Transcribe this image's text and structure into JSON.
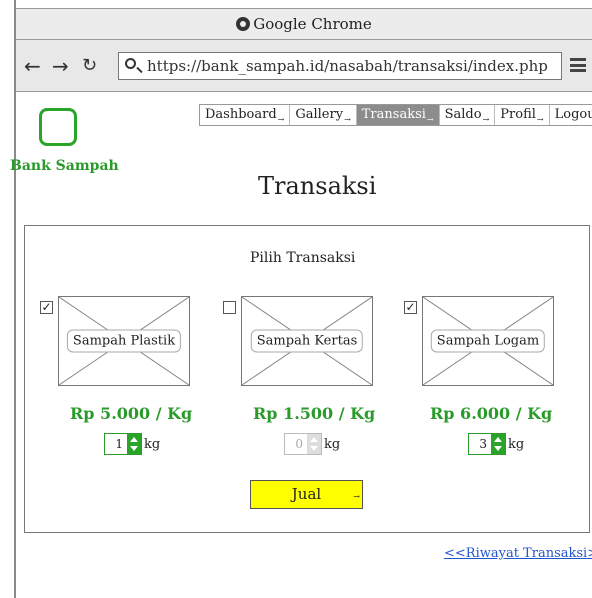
{
  "browser": {
    "title": "Google Chrome",
    "url": "https://bank_sampah.id/nasabah/transaksi/index.php"
  },
  "site": {
    "logo_text": "Bank Sampah"
  },
  "nav": {
    "items": [
      {
        "label": "Dashboard",
        "active": false
      },
      {
        "label": "Gallery",
        "active": false
      },
      {
        "label": "Transaksi",
        "active": true
      },
      {
        "label": "Saldo",
        "active": false
      },
      {
        "label": "Profil",
        "active": false
      },
      {
        "label": "Logout",
        "active": false
      }
    ]
  },
  "page": {
    "title": "Transaksi",
    "panel_title": "Pilih Transaksi"
  },
  "products": [
    {
      "name": "Sampah Plastik",
      "price": "Rp 5.000 / Kg",
      "checked": true,
      "qty": "1",
      "unit": "kg"
    },
    {
      "name": "Sampah Kertas",
      "price": "Rp 1.500 / Kg",
      "checked": false,
      "qty": "0",
      "unit": "kg"
    },
    {
      "name": "Sampah Logam",
      "price": "Rp 6.000 / Kg",
      "checked": true,
      "qty": "3",
      "unit": "kg"
    }
  ],
  "actions": {
    "submit_label": "Jual",
    "history_link": "<<Riwayat Transaksi>>"
  },
  "colors": {
    "accent_green": "#2a9a2a",
    "button_yellow": "#ffff00",
    "active_nav": "#8c8c8c",
    "link_blue": "#2255cc"
  }
}
